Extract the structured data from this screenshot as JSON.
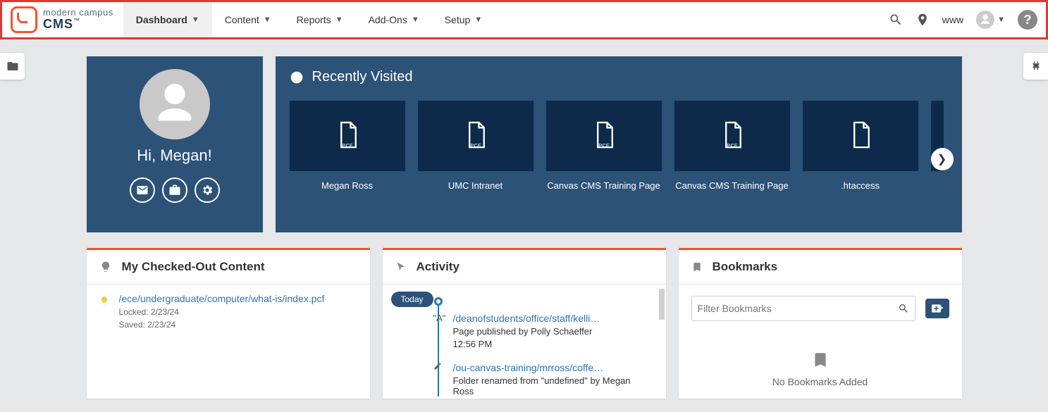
{
  "logo": {
    "line1": "modern campus",
    "line2": "CMS"
  },
  "nav": {
    "items": [
      {
        "label": "Dashboard",
        "active": true
      },
      {
        "label": "Content"
      },
      {
        "label": "Reports"
      },
      {
        "label": "Add-Ons"
      },
      {
        "label": "Setup"
      }
    ]
  },
  "topbar": {
    "site_label": "www"
  },
  "user": {
    "greeting": "Hi, Megan!"
  },
  "recent": {
    "title": "Recently Visited",
    "items": [
      {
        "label": "Megan Ross",
        "type": "pcf"
      },
      {
        "label": "UMC Intranet",
        "type": "pcf"
      },
      {
        "label": "Canvas CMS Training Page",
        "type": "pcf"
      },
      {
        "label": "Canvas CMS Training Page",
        "type": "pcf"
      },
      {
        "label": ".htaccess",
        "type": "file"
      }
    ]
  },
  "checked_out": {
    "title": "My Checked-Out Content",
    "items": [
      {
        "path": "/ece/undergraduate/computer/what-is/index.pcf",
        "locked": "Locked: 2/23/24",
        "saved": "Saved: 2/23/24"
      }
    ]
  },
  "activity": {
    "title": "Activity",
    "today_label": "Today",
    "items": [
      {
        "icon": "publish",
        "link": "/deanofstudents/office/staff/kelli…",
        "desc": "Page published by Polly Schaeffer",
        "time": "12:56 PM"
      },
      {
        "icon": "edit",
        "link": "/ou-canvas-training/mrross/coffe…",
        "desc": "Folder renamed from \"undefined\" by Megan Ross"
      }
    ]
  },
  "bookmarks": {
    "title": "Bookmarks",
    "filter_placeholder": "Filter Bookmarks",
    "empty_text": "No Bookmarks Added"
  }
}
